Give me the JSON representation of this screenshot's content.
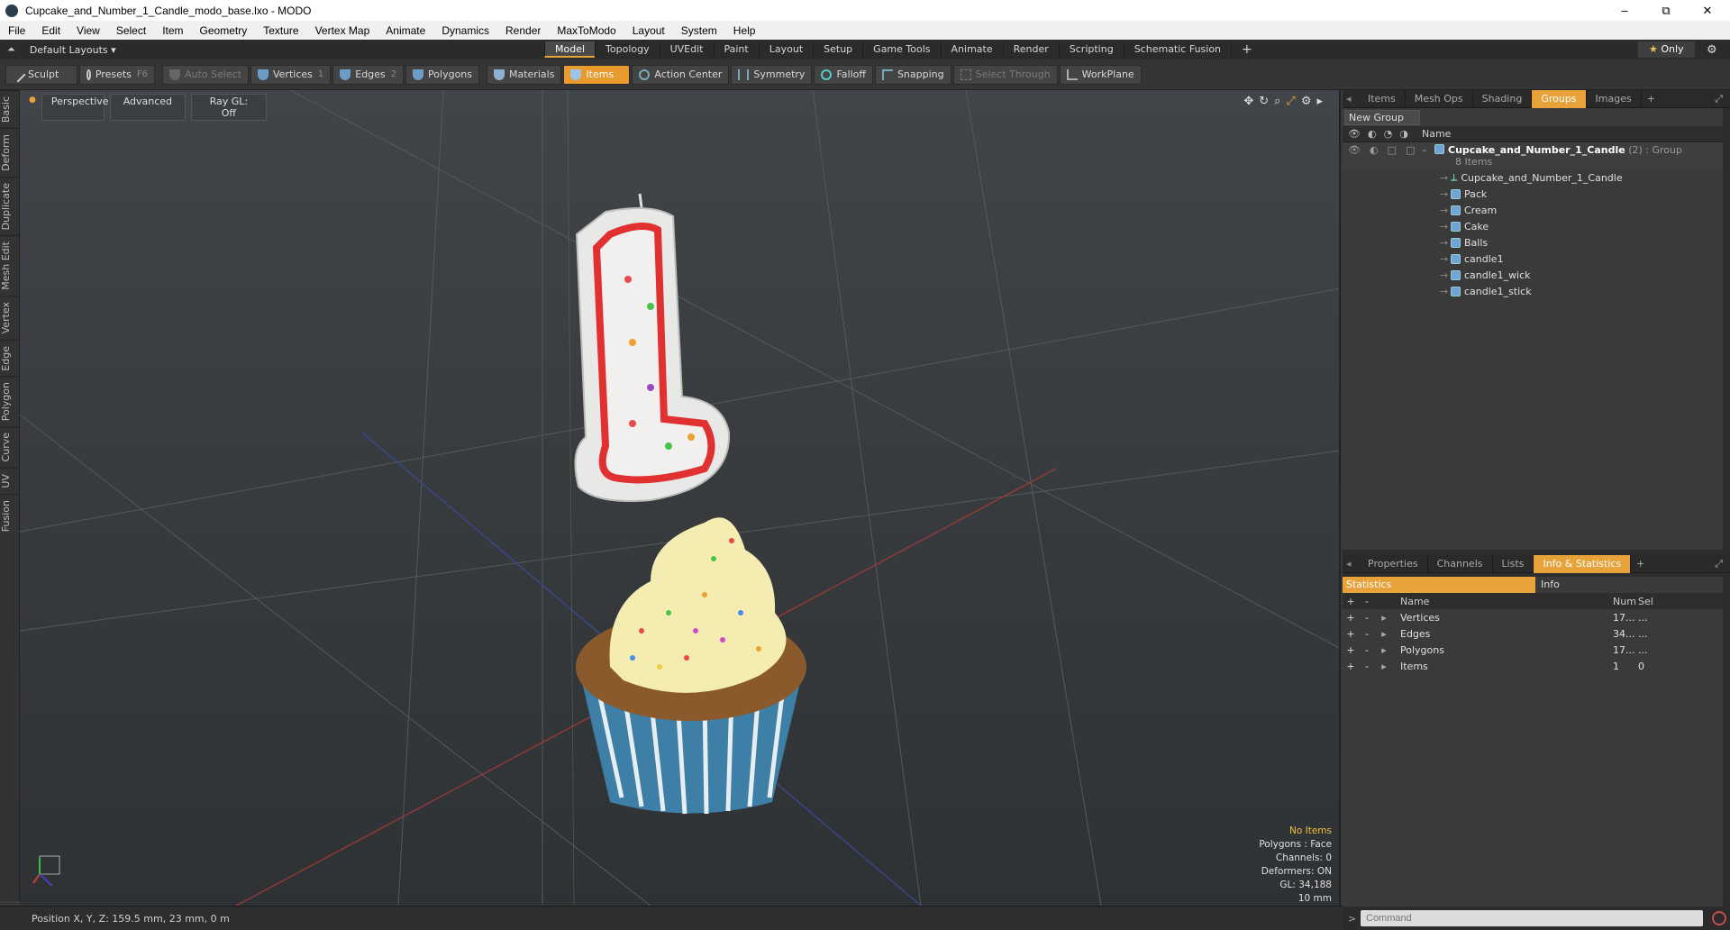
{
  "window": {
    "title": "Cupcake_and_Number_1_Candle_modo_base.lxo - MODO",
    "minimize": "–",
    "maximize": "⧉",
    "close": "✕"
  },
  "menu": [
    "File",
    "Edit",
    "View",
    "Select",
    "Item",
    "Geometry",
    "Texture",
    "Vertex Map",
    "Animate",
    "Dynamics",
    "Render",
    "MaxToModo",
    "Layout",
    "System",
    "Help"
  ],
  "layouts": {
    "default": "Default Layouts",
    "tabs": [
      "Model",
      "Topology",
      "UVEdit",
      "Paint",
      "Layout",
      "Setup",
      "Game Tools",
      "Animate",
      "Render",
      "Scripting",
      "Schematic Fusion"
    ],
    "active": "Model",
    "only_label": "Only"
  },
  "toolbar": {
    "sculpt": "Sculpt",
    "presets": "Presets",
    "presets_key": "F6",
    "auto_select": "Auto Select",
    "vertices": "Vertices",
    "vertices_key": "1",
    "edges": "Edges",
    "edges_key": "2",
    "polygons": "Polygons",
    "materials": "Materials",
    "items": "Items",
    "action_center": "Action Center",
    "symmetry": "Symmetry",
    "falloff": "Falloff",
    "snapping": "Snapping",
    "select_through": "Select Through",
    "workplane": "WorkPlane"
  },
  "left_tabs": [
    "Basic",
    "Deform",
    "Duplicate",
    "Mesh Edit",
    "Vertex",
    "Edge",
    "Polygon",
    "Curve",
    "UV",
    "Fusion"
  ],
  "viewport": {
    "view": "Perspective",
    "advanced": "Advanced",
    "raygl": "Ray GL: Off",
    "info": {
      "no_items": "No Items",
      "polygons": "Polygons : Face",
      "channels": "Channels: 0",
      "deformers": "Deformers: ON",
      "gl": "GL: 34,188",
      "scale": "10 mm"
    }
  },
  "status": {
    "position": "Position X, Y, Z:   159.5 mm, 23 mm, 0 m"
  },
  "top_panel": {
    "tabs": [
      "Items",
      "Mesh Ops",
      "Shading",
      "Groups",
      "Images"
    ],
    "active": "Groups",
    "new_group": "New Group",
    "name_header": "Name",
    "group": {
      "name": "Cupcake_and_Number_1_Candle",
      "count": "(2)",
      "type": ": Group",
      "sub": "8 Items"
    },
    "items": [
      "Cupcake_and_Number_1_Candle",
      "Pack",
      "Cream",
      "Cake",
      "Balls",
      "candle1",
      "candle1_wick",
      "candle1_stick"
    ]
  },
  "bottom_panel": {
    "tabs": [
      "Properties",
      "Channels",
      "Lists",
      "Info & Statistics"
    ],
    "active": "Info & Statistics",
    "stat_tab": "Statistics",
    "info_tab": "Info",
    "headers": {
      "name": "Name",
      "num": "Num",
      "sel": "Sel"
    },
    "rows": [
      {
        "name": "Vertices",
        "num": "17...",
        "sel": "..."
      },
      {
        "name": "Edges",
        "num": "34...",
        "sel": "..."
      },
      {
        "name": "Polygons",
        "num": "17...",
        "sel": "..."
      },
      {
        "name": "Items",
        "num": "1",
        "sel": "0"
      }
    ]
  },
  "command": {
    "placeholder": "Command"
  }
}
